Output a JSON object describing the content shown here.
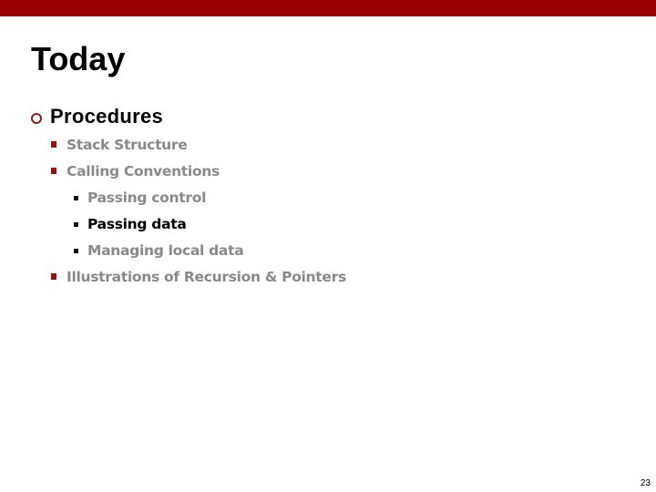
{
  "slide": {
    "accent_color": "#990000",
    "title": "Today",
    "bullets": [
      {
        "label": "Procedures",
        "children": [
          {
            "label": "Stack Structure",
            "active": false,
            "children": []
          },
          {
            "label": "Calling Conventions",
            "active": false,
            "children": [
              {
                "label": "Passing control",
                "active": false
              },
              {
                "label": "Passing data",
                "active": true
              },
              {
                "label": "Managing local data",
                "active": false
              }
            ]
          },
          {
            "label": "Illustrations of Recursion & Pointers",
            "active": false,
            "children": []
          }
        ]
      }
    ],
    "page_number": "23"
  }
}
